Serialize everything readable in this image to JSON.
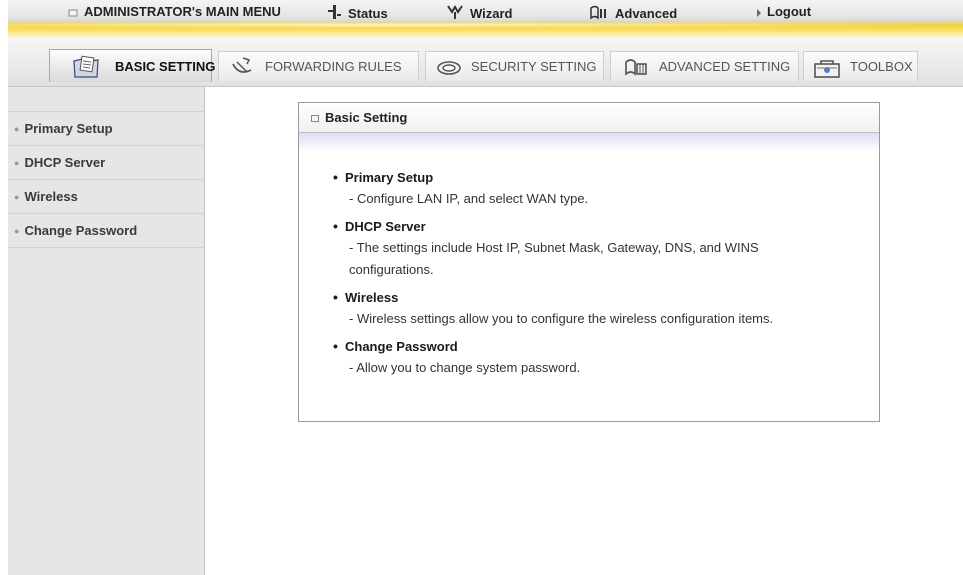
{
  "top_menu": {
    "main_menu": "ADMINISTRATOR's MAIN MENU",
    "status": "Status",
    "wizard": "Wizard",
    "advanced": "Advanced",
    "logout": "Logout"
  },
  "tabs": [
    {
      "label": "BASIC SETTING",
      "icon": "folder-document-icon",
      "active": true
    },
    {
      "label": "FORWARDING RULES",
      "icon": "satellite-dish-icon",
      "active": false
    },
    {
      "label": "SECURITY SETTING",
      "icon": "lock-disc-icon",
      "active": false
    },
    {
      "label": "ADVANCED SETTING",
      "icon": "network-blocks-icon",
      "active": false
    },
    {
      "label": "TOOLBOX",
      "icon": "toolbox-icon",
      "active": false
    }
  ],
  "sidebar": {
    "items": [
      {
        "label": "Primary Setup"
      },
      {
        "label": "DHCP Server"
      },
      {
        "label": "Wireless"
      },
      {
        "label": "Change Password"
      }
    ]
  },
  "panel": {
    "title": "Basic Setting",
    "entries": [
      {
        "title": "Primary Setup",
        "desc": "- Configure LAN IP, and select WAN type."
      },
      {
        "title": "DHCP Server",
        "desc": "- The settings include Host IP, Subnet Mask, Gateway, DNS, and WINS configurations."
      },
      {
        "title": "Wireless",
        "desc": "- Wireless settings allow you to configure the wireless configuration items."
      },
      {
        "title": "Change Password",
        "desc": "- Allow you to change system password."
      }
    ]
  },
  "colors": {
    "accent_gold": "#f3cf3a",
    "sidebar_bg": "#e6e6e6",
    "panel_band": "#dcdcf4"
  }
}
